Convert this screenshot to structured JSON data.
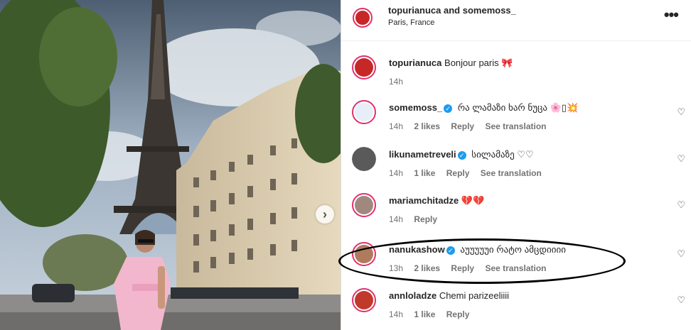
{
  "header": {
    "names": "topurianuca and somemoss_",
    "location": "Paris, France",
    "more_icon": "more-horizontal-icon"
  },
  "photo": {
    "next_icon": "chevron-right-icon",
    "next_glyph": "›"
  },
  "comments": [
    {
      "user": "topurianuca",
      "verified": false,
      "text": "Bonjour paris",
      "emoji": "🎀",
      "time": "14h",
      "likes": "",
      "reply": "",
      "translate": "",
      "heart": false,
      "avatar_color": "#c62828"
    },
    {
      "user": "somemoss_",
      "verified": true,
      "text": "რა ლამაზი ხარ ნუცა",
      "emoji": "🌸▯💥",
      "time": "14h",
      "likes": "2 likes",
      "reply": "Reply",
      "translate": "See translation",
      "heart": true,
      "avatar_color": "#e8eef7"
    },
    {
      "user": "likunametreveli",
      "verified": true,
      "text": "სილამაზე",
      "emoji": "♡♡",
      "time": "14h",
      "likes": "1 like",
      "reply": "Reply",
      "translate": "See translation",
      "heart": true,
      "avatar_color": "#5a5a5a"
    },
    {
      "user": "mariamchitadze",
      "verified": false,
      "text": "",
      "emoji": "💔💔",
      "time": "14h",
      "likes": "",
      "reply": "Reply",
      "translate": "",
      "heart": true,
      "avatar_color": "#a1887f"
    },
    {
      "user": "nanukashow",
      "verified": true,
      "text": "აუუუუუი რატო ამცდიიიი",
      "emoji": "",
      "time": "13h",
      "likes": "2 likes",
      "reply": "Reply",
      "translate": "See translation",
      "heart": true,
      "avatar_color": "#b07a5f"
    },
    {
      "user": "annloladze",
      "verified": false,
      "text": "Chemi parizeeliiii",
      "emoji": "",
      "time": "14h",
      "likes": "1 like",
      "reply": "Reply",
      "translate": "",
      "heart": true,
      "avatar_color": "#c0392b"
    }
  ],
  "icons": {
    "heart": "heart-outline-icon",
    "verified": "verified-badge-icon"
  },
  "colors": {
    "accent_ring": "#e1306c",
    "verified": "#1d9bf0",
    "meta_text": "#737373"
  }
}
